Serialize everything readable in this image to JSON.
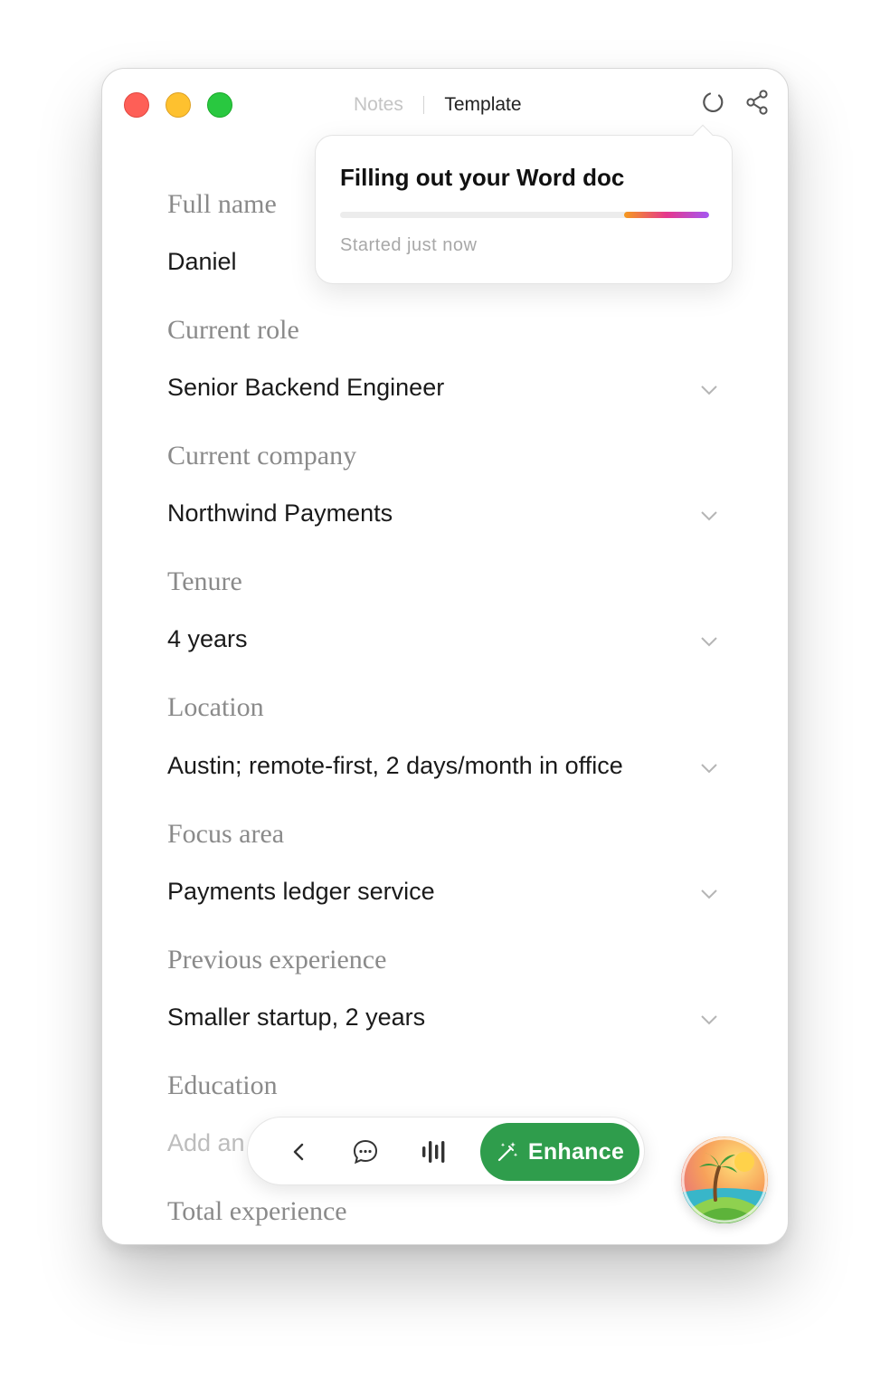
{
  "window": {
    "breadcrumb": {
      "notes": "Notes",
      "template": "Template"
    }
  },
  "popover": {
    "title": "Filling out your Word doc",
    "status": "Started just now",
    "progress": 0.23,
    "colors": [
      "#f59a1e",
      "#e5388d",
      "#a557f2"
    ]
  },
  "fields": [
    {
      "label": "Full name",
      "value": "Daniel"
    },
    {
      "label": "Current role",
      "value": "Senior Backend Engineer"
    },
    {
      "label": "Current company",
      "value": "Northwind Payments"
    },
    {
      "label": "Tenure",
      "value": "4 years"
    },
    {
      "label": "Location",
      "value": "Austin; remote-first, 2 days/month in office"
    },
    {
      "label": "Focus area",
      "value": "Payments ledger service"
    },
    {
      "label": "Previous experience",
      "value": "Smaller startup, 2 years"
    },
    {
      "label": "Education",
      "placeholder": "Add an"
    },
    {
      "label": "Total experience"
    }
  ],
  "toolbar": {
    "back_icon": "chevron-left-icon",
    "chat_icon": "chat-bubble-icon",
    "audio_icon": "audio-waveform-icon",
    "enhance_label": "Enhance",
    "enhance_color": "#2f9d4c"
  },
  "icons": {
    "sync": "sync-icon",
    "share": "share-icon",
    "avatar": "tropical-island-avatar"
  }
}
